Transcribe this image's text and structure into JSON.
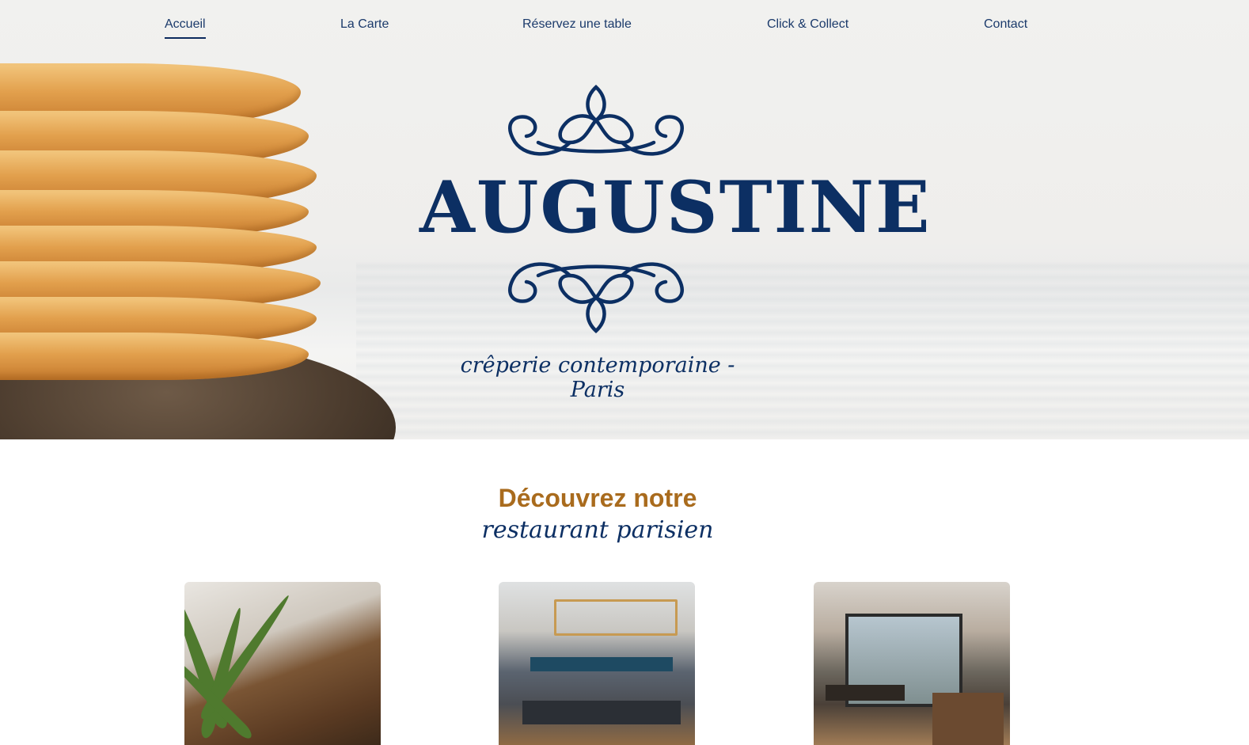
{
  "nav": {
    "items": [
      {
        "label": "Accueil",
        "active": true
      },
      {
        "label": "La Carte",
        "active": false
      },
      {
        "label": "Réservez une table",
        "active": false
      },
      {
        "label": "Click & Collect",
        "active": false
      },
      {
        "label": "Contact",
        "active": false
      }
    ]
  },
  "hero": {
    "brand": "AUGUSTINE",
    "tagline": "crêperie contemporaine - Paris",
    "logo_icons": [
      "flourish-top-icon",
      "flourish-bottom-icon"
    ],
    "brand_color": "#0c2f63"
  },
  "section": {
    "title_line1": "Découvrez notre",
    "title_line2": "restaurant parisien",
    "accent_color": "#a96b1d"
  },
  "gallery": {
    "images": [
      "staircase-photo",
      "dining-room-photo",
      "window-seating-photo"
    ]
  }
}
